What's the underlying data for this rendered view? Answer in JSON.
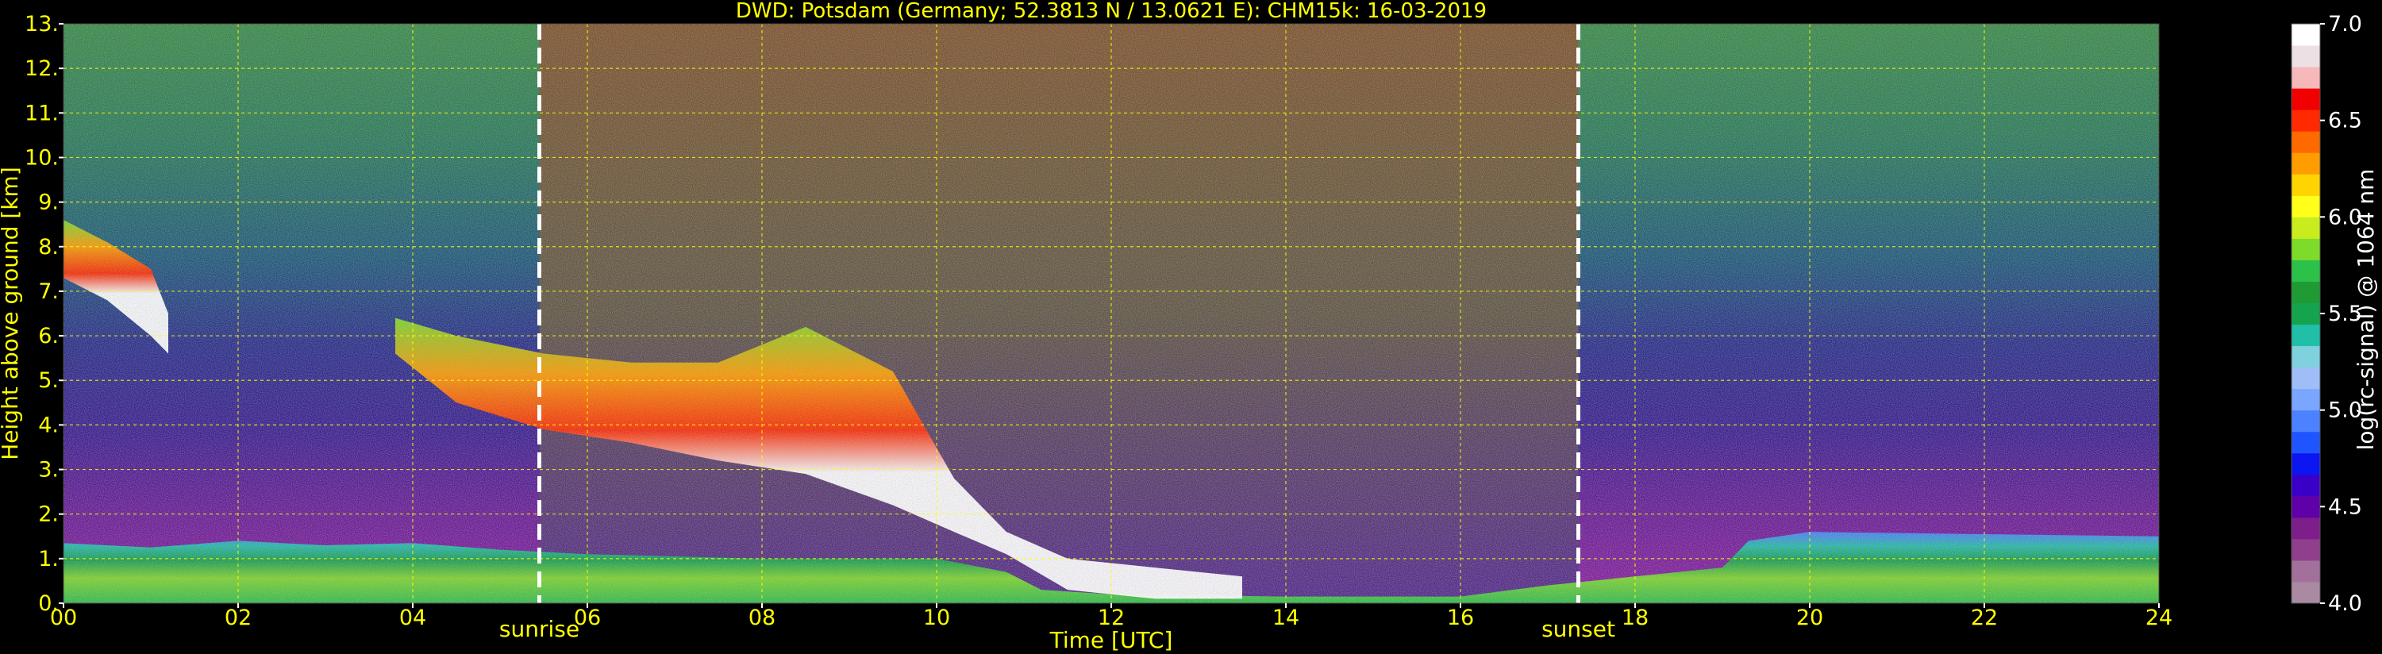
{
  "chart_data": {
    "type": "heatmap",
    "title": "DWD: Potsdam (Germany; 52.3813 N / 13.0621 E):    CHM15k: 16-03-2019",
    "xlabel": "Time [UTC]",
    "ylabel": "Height above ground [km]",
    "xlim": [
      0,
      24
    ],
    "ylim": [
      0,
      13
    ],
    "x_ticks": [
      "00",
      "02",
      "04",
      "06",
      "08",
      "10",
      "12",
      "14",
      "16",
      "18",
      "20",
      "22",
      "24"
    ],
    "y_ticks": [
      "0.",
      "1.",
      "2.",
      "3.",
      "4.",
      "5.",
      "6.",
      "7.",
      "8.",
      "9.",
      "10.",
      "11.",
      "12.",
      "13."
    ],
    "grid": true,
    "colorbar": {
      "label": "log(rc-signal) @ 1064 nm",
      "range": [
        4.0,
        7.0
      ],
      "ticks": [
        "4.0",
        "4.5",
        "5.0",
        "5.5",
        "6.0",
        "6.5",
        "7.0"
      ],
      "colors": [
        "#a98aa2",
        "#a3709b",
        "#8f3f8c",
        "#7e1e8a",
        "#6000a8",
        "#3b00c8",
        "#0b16f0",
        "#1f55ff",
        "#4c82ff",
        "#7aa6ff",
        "#9fbef8",
        "#7fd1de",
        "#22bfa8",
        "#15a34d",
        "#1f9a35",
        "#2cc24a",
        "#7edb2a",
        "#c8ec1e",
        "#ffff1a",
        "#ffd400",
        "#ff9d00",
        "#ff6a00",
        "#ff2a00",
        "#f00000",
        "#f6b8b8",
        "#ece0e4",
        "#ffffff"
      ]
    },
    "annotations": [
      {
        "text": "sunrise",
        "x": 5.45
      },
      {
        "text": "sunset",
        "x": 17.35
      }
    ],
    "series": [
      {
        "name": "",
        "layer": "boundary_layer",
        "x": [
          0,
          1,
          2,
          3,
          4,
          5,
          6,
          8,
          10,
          10.8,
          11.2,
          12,
          14,
          16,
          17,
          18,
          19,
          19.3,
          20,
          22,
          24
        ],
        "bottom": [
          0,
          0,
          0,
          0,
          0,
          0,
          0,
          0,
          0,
          0,
          0,
          0,
          0,
          0,
          0,
          0,
          0,
          0,
          0,
          0,
          0
        ],
        "top": [
          1.35,
          1.25,
          1.4,
          1.3,
          1.35,
          1.2,
          1.1,
          1.0,
          1.0,
          0.7,
          0.3,
          0.2,
          0.15,
          0.15,
          0.4,
          0.6,
          0.8,
          1.4,
          1.6,
          1.55,
          1.5
        ]
      },
      {
        "name": "",
        "layer": "cirrus_early",
        "x": [
          0,
          0.5,
          1.0,
          1.2
        ],
        "bottom": [
          7.3,
          6.8,
          6.0,
          5.6
        ],
        "top": [
          8.6,
          8.1,
          7.5,
          6.5
        ]
      },
      {
        "name": "",
        "layer": "cloud_band",
        "x": [
          3.8,
          4.5,
          5.5,
          6.5,
          7.5,
          8.5,
          9.5,
          10.2,
          10.8,
          11.5,
          12.5,
          13.5
        ],
        "bottom": [
          5.6,
          4.5,
          3.9,
          3.6,
          3.2,
          2.9,
          2.2,
          1.6,
          1.1,
          0.3,
          0.1,
          0.1
        ],
        "top": [
          6.4,
          6.0,
          5.6,
          5.4,
          5.4,
          6.2,
          5.2,
          2.8,
          1.6,
          1.0,
          0.8,
          0.6
        ]
      }
    ]
  }
}
